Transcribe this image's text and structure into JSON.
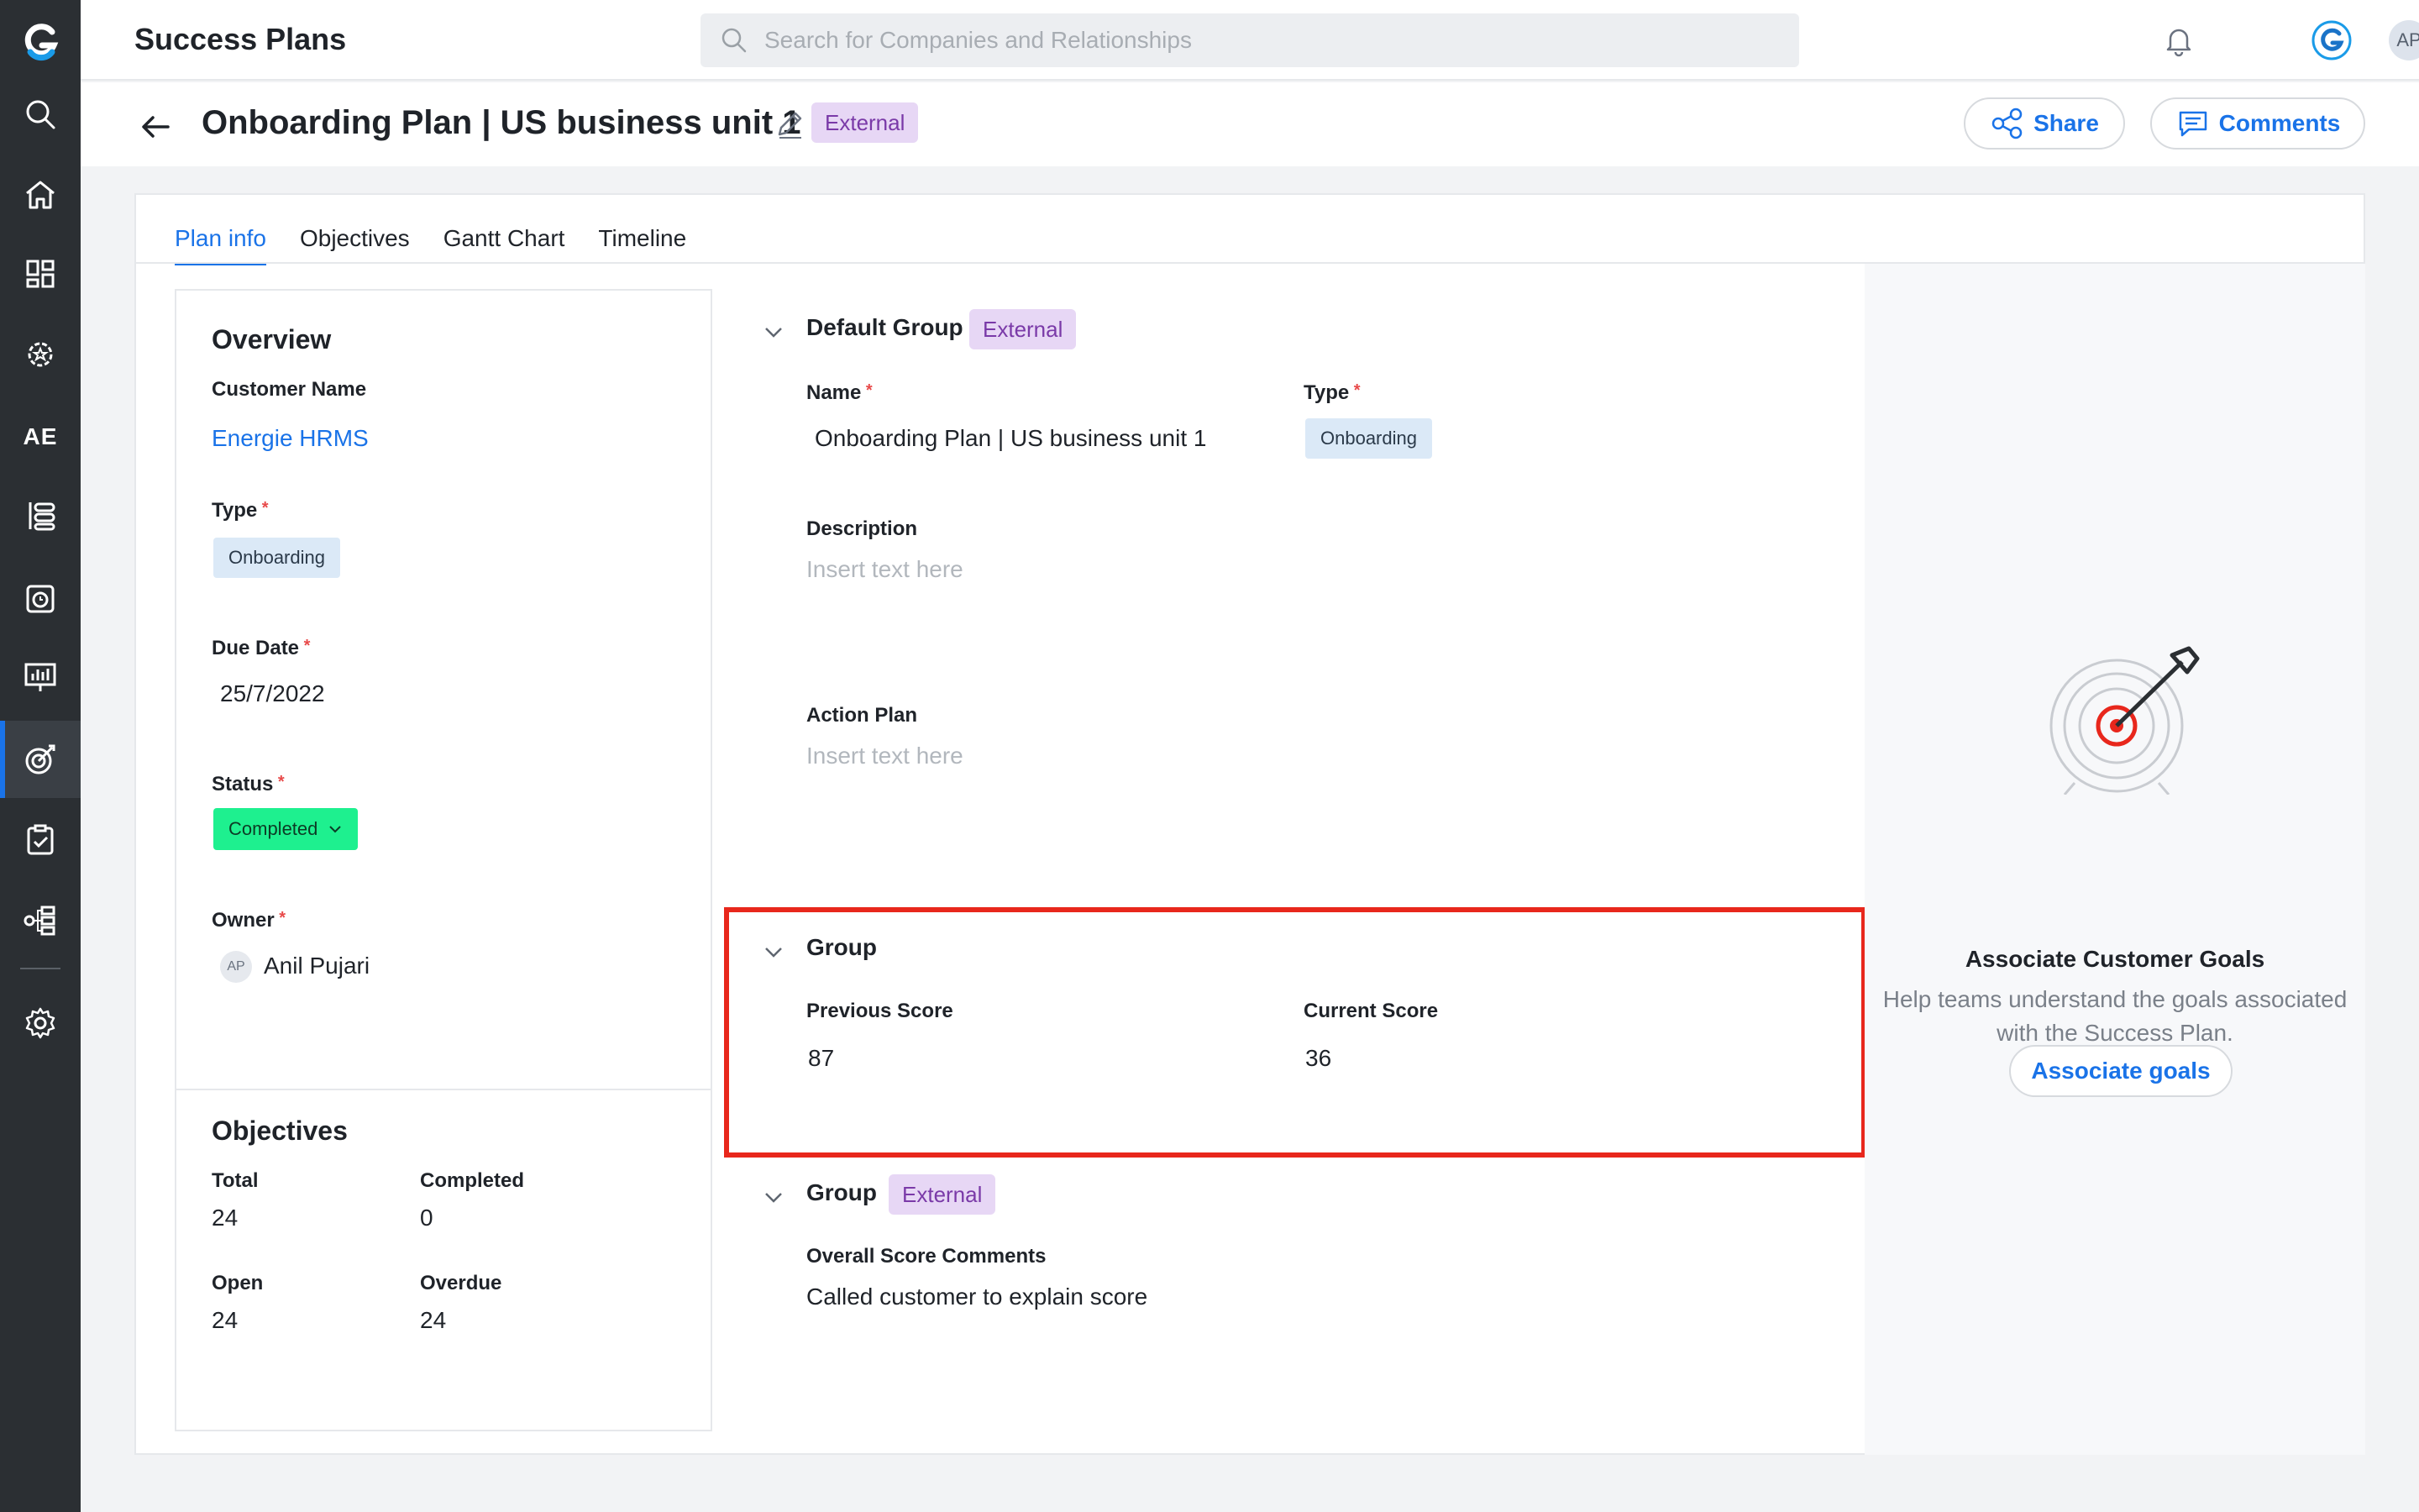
{
  "sidebar": {
    "logo": "gainsight-logo",
    "items": [
      {
        "icon": "search-icon"
      },
      {
        "icon": "home-icon"
      },
      {
        "icon": "dashboard-icon"
      },
      {
        "icon": "settings-star-icon"
      },
      {
        "icon": "text",
        "label": "AE"
      },
      {
        "icon": "timeline-list-icon"
      },
      {
        "icon": "clock-calendar-icon"
      },
      {
        "icon": "bar-chart-board-icon"
      },
      {
        "icon": "target-icon",
        "active": true
      },
      {
        "icon": "clipboard-check-icon"
      },
      {
        "icon": "hierarchy-icon"
      },
      {
        "icon": "gear-icon"
      }
    ]
  },
  "topbar": {
    "title": "Success Plans",
    "search_placeholder": "Search for Companies and Relationships",
    "avatar_initials": "AP"
  },
  "header": {
    "plan_title": "Onboarding Plan | US business unit 1",
    "tag": "External",
    "share_label": "Share",
    "comments_label": "Comments"
  },
  "tabs": [
    "Plan info",
    "Objectives",
    "Gantt Chart",
    "Timeline"
  ],
  "overview": {
    "title": "Overview",
    "customer_name_label": "Customer Name",
    "customer_name": "Energie HRMS",
    "type_label": "Type",
    "type_value": "Onboarding",
    "due_date_label": "Due Date",
    "due_date": "25/7/2022",
    "status_label": "Status",
    "status_value": "Completed",
    "owner_label": "Owner",
    "owner_initials": "AP",
    "owner_name": "Anil Pujari"
  },
  "objectives": {
    "title": "Objectives",
    "total_label": "Total",
    "total": "24",
    "completed_label": "Completed",
    "completed": "0",
    "open_label": "Open",
    "open": "24",
    "overdue_label": "Overdue",
    "overdue": "24"
  },
  "default_group": {
    "title": "Default Group",
    "tag": "External",
    "name_label": "Name",
    "name_value": "Onboarding Plan | US business unit 1",
    "type_label": "Type",
    "type_value": "Onboarding",
    "description_label": "Description",
    "description_placeholder": "Insert text here",
    "action_plan_label": "Action Plan",
    "action_plan_placeholder": "Insert text here"
  },
  "score_group": {
    "title": "Group",
    "previous_label": "Previous Score",
    "previous_value": "87",
    "current_label": "Current Score",
    "current_value": "36"
  },
  "comments_group": {
    "title": "Group",
    "tag": "External",
    "comments_label": "Overall Score Comments",
    "comments_value": "Called customer to explain score"
  },
  "goals": {
    "title": "Associate Customer Goals",
    "description": "Help teams understand the goals associated with the Success Plan.",
    "button_label": "Associate goals"
  },
  "colors": {
    "sidebar_bg": "#2b2f33",
    "accent": "#1a73e8",
    "status_green": "#1ef08f",
    "external_tag_bg": "#e7d7f5",
    "highlight_red": "#e8271c"
  }
}
